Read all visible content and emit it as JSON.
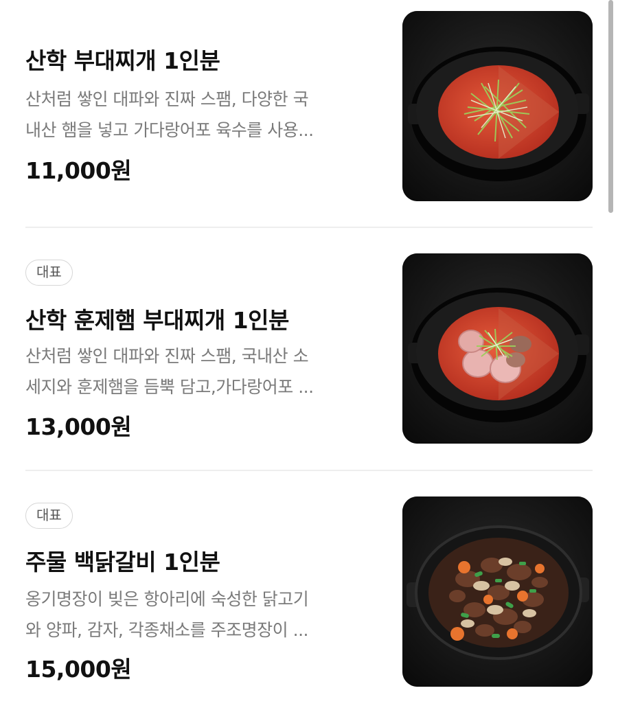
{
  "menu": {
    "items": [
      {
        "badge": "",
        "title": "산학 부대찌개 1인분",
        "desc_line1": "산처럼 쌓인 대파와 진짜 스팸, 다양한 국",
        "desc_line2": "내산 햄을 넣고 가다랑어포 육수를 사용...",
        "price": "11,000원",
        "image_icon": "budae-jjigae-scallion-photo"
      },
      {
        "badge": "대표",
        "title": "산학 훈제햄 부대찌개 1인분",
        "desc_line1": "산처럼 쌓인 대파와 진짜 스팸, 국내산 소",
        "desc_line2": "세지와 훈제햄을 듬뿍 담고,가다랑어포 ...",
        "price": "13,000원",
        "image_icon": "smoked-ham-budae-jjigae-photo"
      },
      {
        "badge": "대표",
        "title": "주물 백닭갈비 1인분",
        "desc_line1": "옹기명장이 빚은 항아리에 숙성한 닭고기",
        "desc_line2": "와 양파, 감자, 각종채소를 주조명장이 ...",
        "price": "15,000원",
        "image_icon": "cast-iron-dakgalbi-photo"
      }
    ]
  },
  "colors": {
    "text_primary": "#111111",
    "text_secondary": "#7a7a7a",
    "badge_border": "#d6d6d6",
    "divider": "#eeeeee",
    "broth_red": "#d9482e"
  }
}
